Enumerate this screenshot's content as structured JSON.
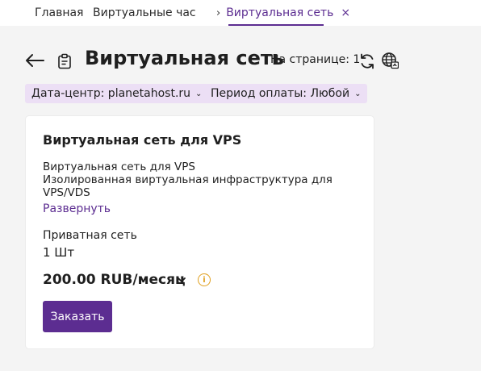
{
  "tabs": {
    "home": "Главная",
    "vms": "Виртуальные час",
    "active": "Виртуальная сеть",
    "active_chevron": "›",
    "close": "×"
  },
  "header": {
    "title": "Виртуальная сеть",
    "per_page": "На странице: 1",
    "icons": [
      "back-arrow-icon",
      "clipboard-icon",
      "refresh-icon",
      "globe-icon"
    ]
  },
  "filters": {
    "datacenter": "Дата-центр: planetahost.ru",
    "payment_period": "Период оплаты: Любой",
    "arrow": "⌄"
  },
  "card": {
    "title": "Виртуальная сеть для VPS",
    "description_lines": [
      "Виртуальная сеть для VPS",
      "Изолированная виртуальная инфраструктура для",
      "VPS/VDS"
    ],
    "expand": "Развернуть",
    "private_net_label": "Приватная сеть",
    "quantity": "1 Шт",
    "price": "200.00 RUB/месяц",
    "info_glyph": "i",
    "order_button": "Заказать"
  },
  "colors": {
    "accent": "#5c2d91",
    "filter_bg": "#ecdff5",
    "info": "#e0a020",
    "page_bg": "#f4f4f4"
  }
}
